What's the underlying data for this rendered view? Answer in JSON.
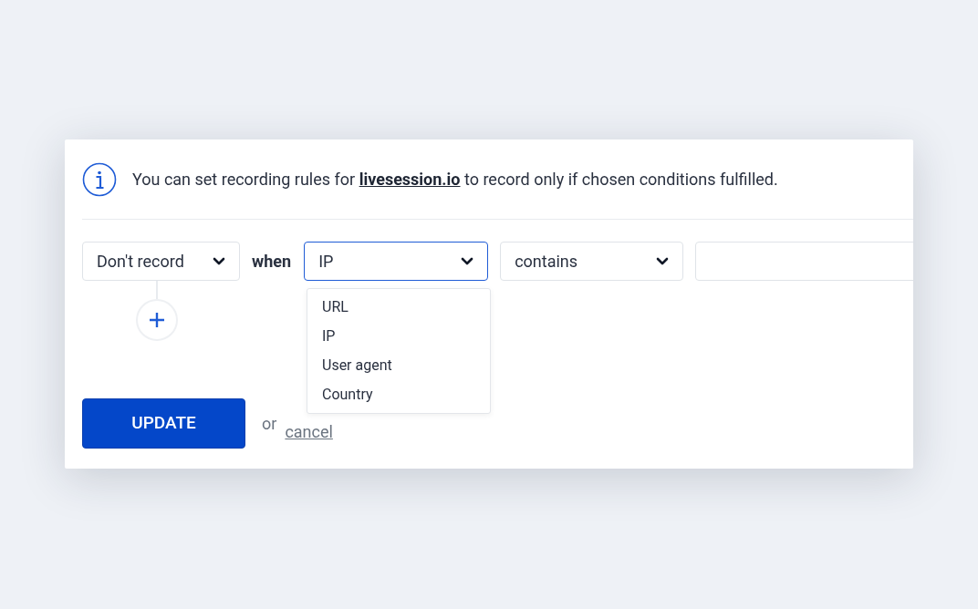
{
  "info": {
    "before": "You can set recording rules for",
    "link": "livesession.io",
    "after": "to record only if chosen conditions fulfilled."
  },
  "rule": {
    "action": "Don't record",
    "connector": "when",
    "field": {
      "value": "IP",
      "focused": true,
      "expanded": true,
      "options": [
        "URL",
        "IP",
        "User agent",
        "Country"
      ]
    },
    "operator": "contains"
  },
  "actions": {
    "submit": "UPDATE",
    "or": "or",
    "cancel": "cancel"
  }
}
